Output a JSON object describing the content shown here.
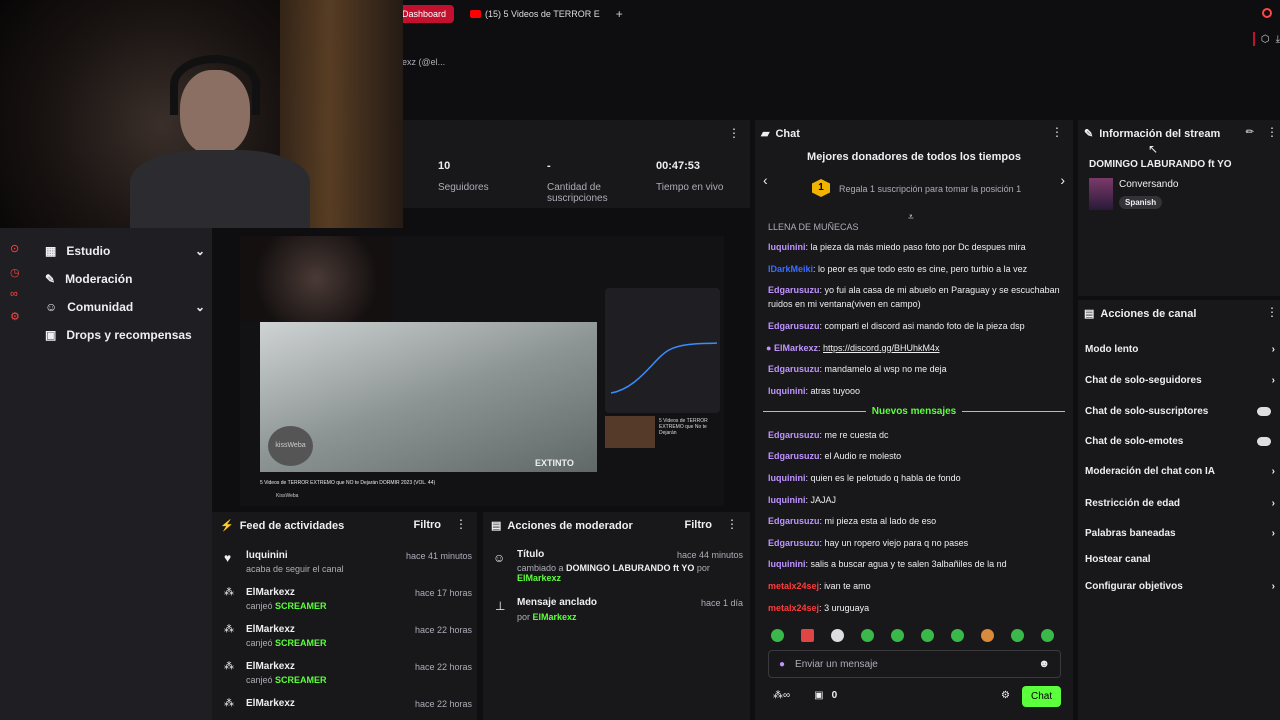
{
  "browser": {
    "tab_dashboard": "Dashboard",
    "tab_youtube": "(15) 5 Videos de TERROR E",
    "new_tab": "+",
    "address_partial": "exz (@el..."
  },
  "stats": {
    "followers_value": "10",
    "followers_label": "Seguidores",
    "subs_value": "-",
    "subs_label": "Cantidad de suscripciones",
    "live_value": "00:47:53",
    "live_label": "Tiempo en vivo"
  },
  "sidebar": {
    "items": [
      {
        "label": "Estudio",
        "icon": "video-icon",
        "has_chevron": true
      },
      {
        "label": "Moderación",
        "icon": "wrench-icon",
        "has_chevron": false
      },
      {
        "label": "Comunidad",
        "icon": "people-icon",
        "has_chevron": true
      },
      {
        "label": "Drops y recompensas",
        "icon": "gift-icon",
        "has_chevron": false
      }
    ]
  },
  "preview": {
    "video_title": "5 Videos de TERROR EXTREMO que NO te Dejarán DORMIR 2023 (VOL. 44)",
    "channel": "KissWeba",
    "watermark": "EXTINTO",
    "logo_text": "kissWeba",
    "rec_text": "5 Videos de TERROR EXTREMO que No te Dejarán"
  },
  "feed": {
    "title": "Feed de actividades",
    "filter": "Filtro",
    "items": [
      {
        "user": "luquinini",
        "time": "hace 41 minutos",
        "prefix": "acaba de seguir el canal",
        "highlight": ""
      },
      {
        "user": "ElMarkexz",
        "time": "hace 17 horas",
        "prefix": "canjeó",
        "highlight": "SCREAMER"
      },
      {
        "user": "ElMarkexz",
        "time": "hace 22 horas",
        "prefix": "canjeó",
        "highlight": "SCREAMER"
      },
      {
        "user": "ElMarkexz",
        "time": "hace 22 horas",
        "prefix": "canjeó",
        "highlight": "SCREAMER"
      },
      {
        "user": "ElMarkexz",
        "time": "hace 22 horas",
        "prefix": "",
        "highlight": ""
      }
    ]
  },
  "mod": {
    "title": "Acciones de moderador",
    "filter": "Filtro",
    "items": [
      {
        "title": "Título",
        "time": "hace 44 minutos",
        "desc_prefix": "cambiado a",
        "desc_bold": "DOMINGO LABURANDO ft YO",
        "desc_por": "por",
        "user": "ElMarkexz"
      },
      {
        "title": "Mensaje anclado",
        "time": "hace 1 día",
        "desc_prefix": "",
        "desc_bold": "",
        "desc_por": "por",
        "user": "ElMarkexz"
      }
    ]
  },
  "chat": {
    "title": "Chat",
    "donors_title": "Mejores donadores de todos los tiempos",
    "donor_rank": "1",
    "donor_text": "Regala 1 suscripción para tomar la posición 1",
    "partial_top": "LLENA DE MUÑECAS",
    "new_messages": "Nuevos mensajes",
    "messages_before": [
      {
        "user": "luquinini",
        "color": "#bf94ff",
        "text": "la pieza da más miedo paso foto por Dc despues mira"
      },
      {
        "user": "IDarkMeiki",
        "color": "#3b6cff",
        "text": "lo peor es que todo esto es cine, pero turbio a la vez"
      },
      {
        "user": "Edgarusuzu",
        "color": "#bf94ff",
        "text": "yo fui ala casa de mi abuelo en Paraguay y se escuchaban ruidos en mi ventana(viven en campo)"
      },
      {
        "user": "Edgarusuzu",
        "color": "#bf94ff",
        "text": "comparti el discord asi mando foto de la pieza dsp"
      },
      {
        "user": "ElMarkexz",
        "color": "#bf94ff",
        "text": "https://discord.gg/BHUhkM4x",
        "is_link": true
      },
      {
        "user": "Edgarusuzu",
        "color": "#bf94ff",
        "text": "mandamelo al wsp no me deja"
      },
      {
        "user": "luquinini",
        "color": "#bf94ff",
        "text": "atras tuyooo"
      }
    ],
    "messages_after": [
      {
        "user": "Edgarusuzu",
        "color": "#bf94ff",
        "text": "me re cuesta dc"
      },
      {
        "user": "Edgarusuzu",
        "color": "#bf94ff",
        "text": "el Audio re molesto"
      },
      {
        "user": "luquinini",
        "color": "#bf94ff",
        "text": "quien es le pelotudo q habla de fondo"
      },
      {
        "user": "luquinini",
        "color": "#bf94ff",
        "text": "JAJAJ"
      },
      {
        "user": "Edgarusuzu",
        "color": "#bf94ff",
        "text": "mi pieza esta al lado de eso"
      },
      {
        "user": "Edgarusuzu",
        "color": "#bf94ff",
        "text": "hay un ropero viejo para q no pases"
      },
      {
        "user": "luquinini",
        "color": "#bf94ff",
        "text": "salis a buscar agua y te salen 3albañiles de la nd"
      },
      {
        "user": "metalx24sej",
        "color": "#ff3b3b",
        "text": "ivan te amo"
      },
      {
        "user": "metalx24sej",
        "color": "#ff3b3b",
        "text": "3 uruguaya"
      }
    ],
    "input_placeholder": "Enviar un mensaje",
    "points": "0",
    "send_label": "Chat"
  },
  "info": {
    "title": "Información del stream",
    "stream_title": "DOMINGO LABURANDO ft YO",
    "category": "Conversando",
    "language": "Spanish"
  },
  "actions": {
    "title": "Acciones de canal",
    "items": [
      {
        "label": "Modo lento",
        "control": "chevron"
      },
      {
        "label": "Chat de solo-seguidores",
        "control": "chevron"
      },
      {
        "label": "Chat de solo-suscriptores",
        "control": "toggle"
      },
      {
        "label": "Chat de solo-emotes",
        "control": "toggle"
      },
      {
        "label": "Moderación del chat con IA",
        "control": "chevron"
      },
      {
        "label": "Restricción de edad",
        "control": "chevron"
      },
      {
        "label": "Palabras baneadas",
        "control": "chevron"
      },
      {
        "label": "Hostear canal",
        "control": "none"
      },
      {
        "label": "Configurar objetivos",
        "control": "chevron"
      }
    ]
  },
  "colors": {
    "accent": "#5cff3b",
    "purple": "#bf94ff",
    "brand_red": "#ff4545"
  }
}
